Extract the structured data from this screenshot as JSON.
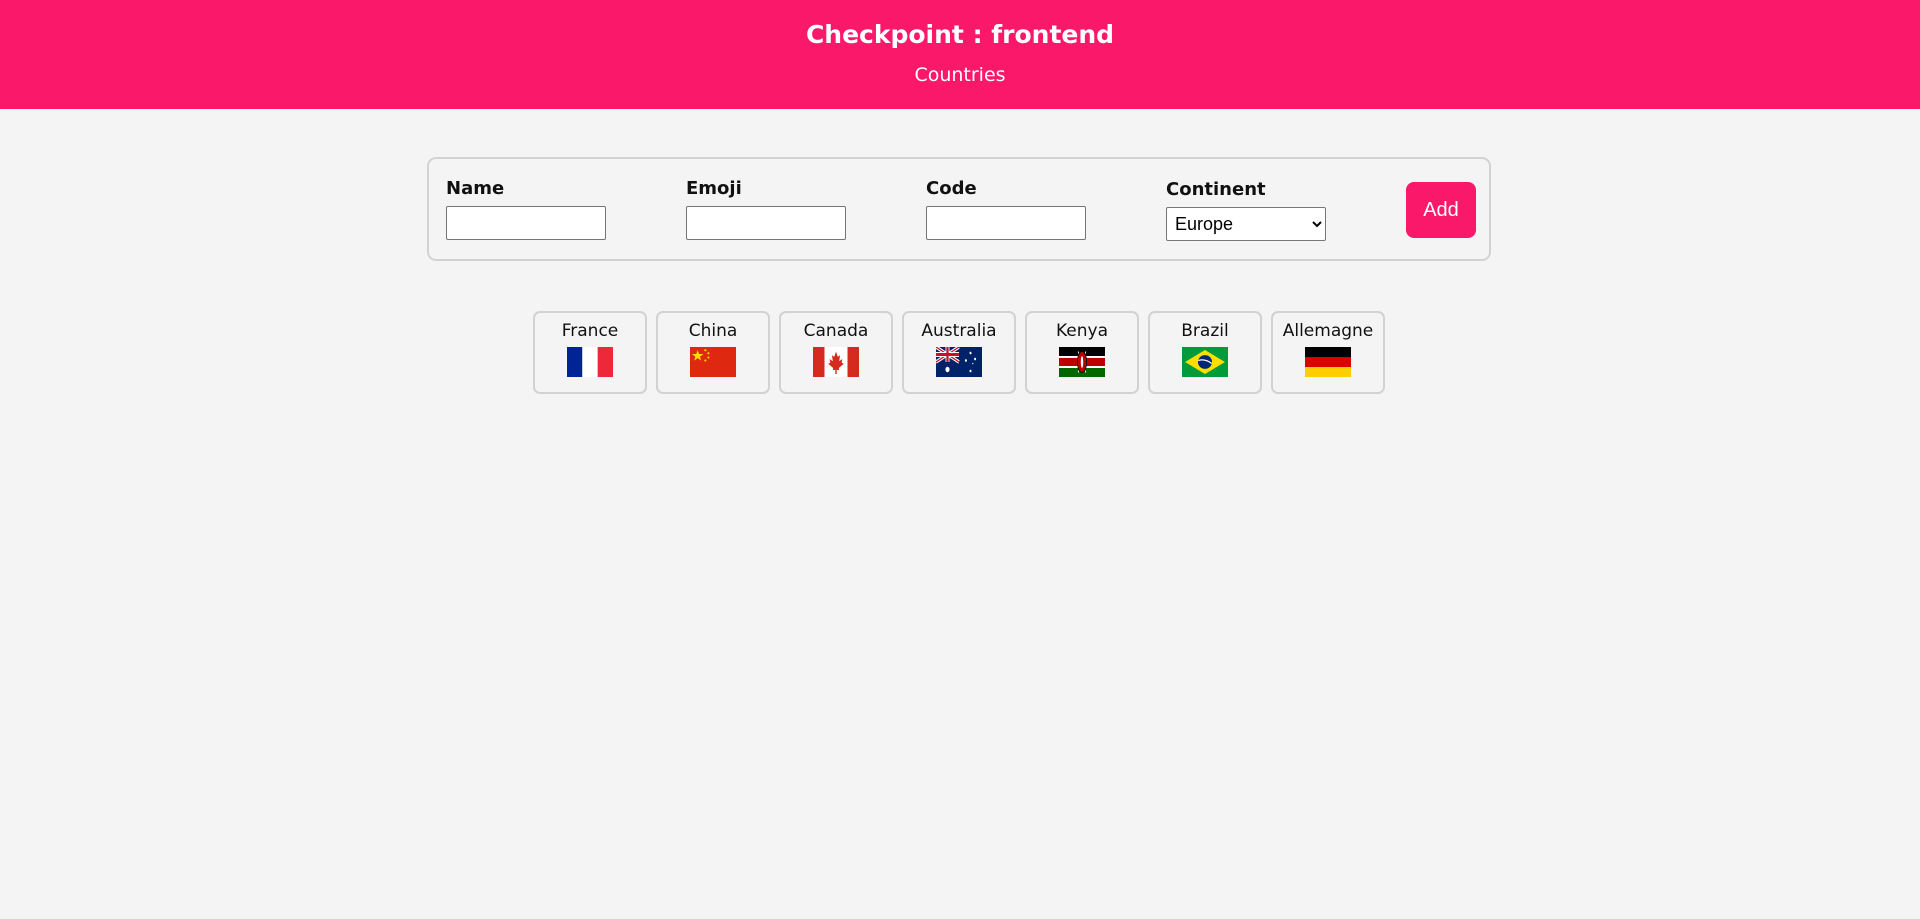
{
  "header": {
    "title": "Checkpoint : frontend",
    "subtitle": "Countries",
    "background_color": "#fa186b"
  },
  "form": {
    "name": {
      "label": "Name",
      "value": ""
    },
    "emoji": {
      "label": "Emoji",
      "value": ""
    },
    "code": {
      "label": "Code",
      "value": ""
    },
    "continent": {
      "label": "Continent",
      "selected": "Europe"
    },
    "add_label": "Add"
  },
  "countries": [
    {
      "name": "France",
      "flag_icon": "france-flag-icon"
    },
    {
      "name": "China",
      "flag_icon": "china-flag-icon"
    },
    {
      "name": "Canada",
      "flag_icon": "canada-flag-icon"
    },
    {
      "name": "Australia",
      "flag_icon": "australia-flag-icon"
    },
    {
      "name": "Kenya",
      "flag_icon": "kenya-flag-icon"
    },
    {
      "name": "Brazil",
      "flag_icon": "brazil-flag-icon"
    },
    {
      "name": "Allemagne",
      "flag_icon": "germany-flag-icon"
    }
  ]
}
